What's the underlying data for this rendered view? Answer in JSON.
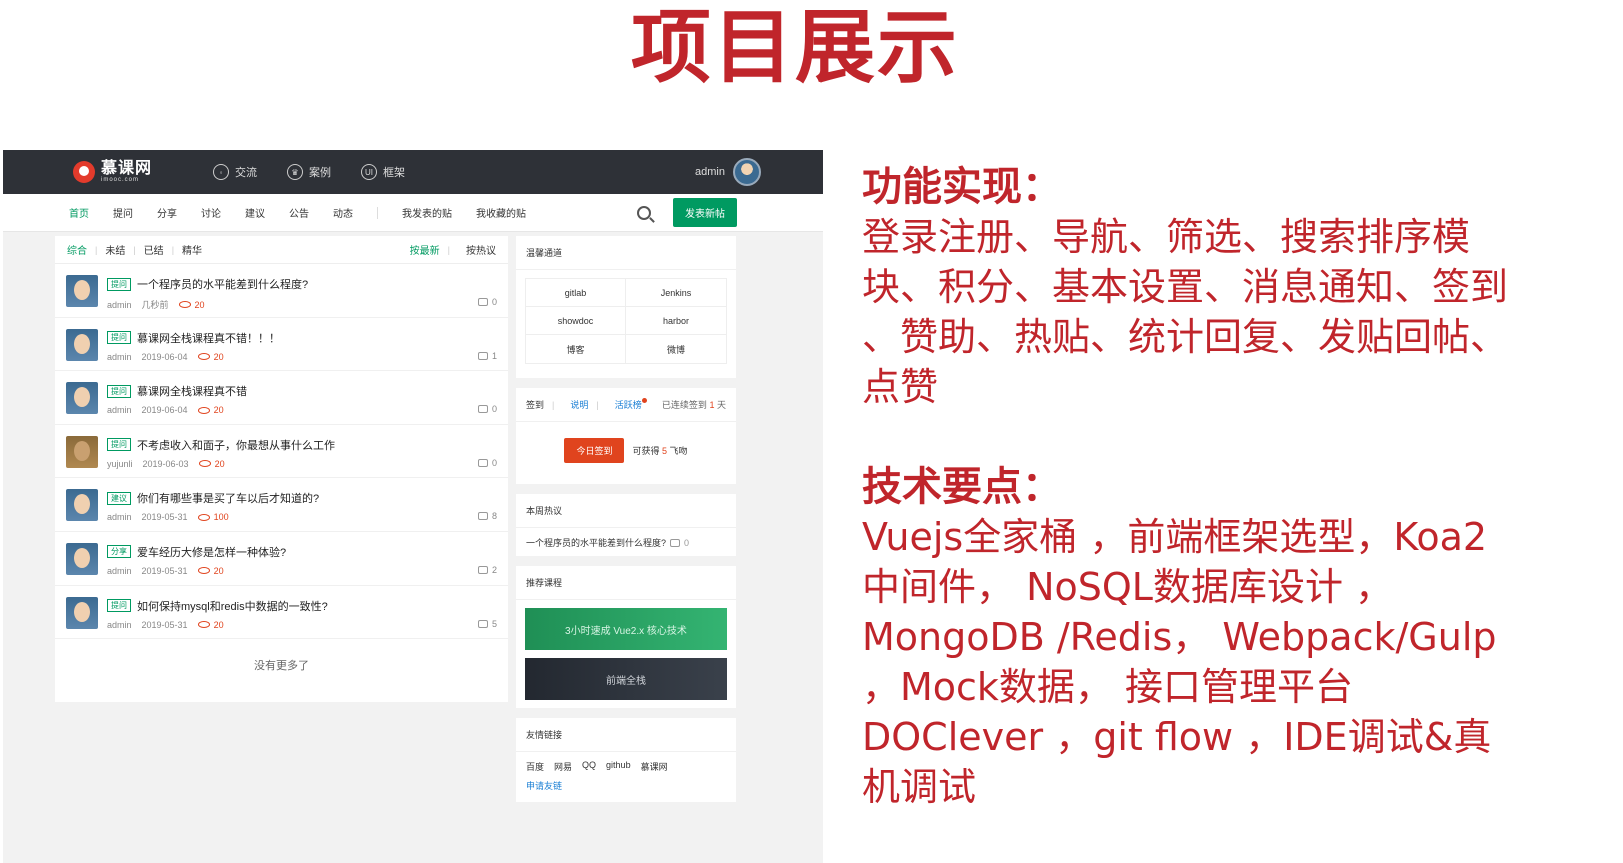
{
  "slide": {
    "title": "项目展示",
    "features_heading": "功能实现：",
    "features_lines": [
      "登录注册、导航、筛选、搜索排序模",
      "块、积分、基本设置、消息通知、签到",
      "、赞助、热贴、统计回复、发贴回帖、",
      "点赞"
    ],
    "tech_heading": "技术要点：",
    "tech_lines": [
      "Vuejs全家桶 ，前端框架选型，Koa2",
      "中间件， NoSQL数据库设计 ，",
      "MongoDB /Redis， Webpack/Gulp",
      "，Mock数据， 接口管理平台",
      "DOClever ，git flow ，IDE调试&真",
      "机调试"
    ],
    "colors": {
      "accent": "#c0252b"
    }
  },
  "app": {
    "logo": {
      "cn": "慕课网",
      "en": "imooc.com"
    },
    "topnav": [
      {
        "label": "交流",
        "icon": "chat-icon"
      },
      {
        "label": "案例",
        "icon": "crown-icon"
      },
      {
        "label": "框架",
        "icon": "ui-icon"
      }
    ],
    "user": {
      "name": "admin"
    },
    "subnav": [
      "首页",
      "提问",
      "分享",
      "讨论",
      "建议",
      "公告",
      "动态"
    ],
    "subnav_mine": [
      "我发表的贴",
      "我收藏的贴"
    ],
    "post_button": "发表新帖",
    "colors": {
      "brand_green": "#009a61",
      "topbar": "#2e3137",
      "orange": "#e0441e"
    }
  },
  "list": {
    "filters": [
      "综合",
      "未结",
      "已结",
      "精华"
    ],
    "sorts": [
      "按最新",
      "按热议"
    ],
    "rows": [
      {
        "tag": "提问",
        "title": "一个程序员的水平能差到什么程度?",
        "user": "admin",
        "time": "几秒前",
        "points": "20",
        "comments": "0"
      },
      {
        "tag": "提问",
        "title": "慕课网全栈课程真不错！！！",
        "user": "admin",
        "time": "2019-06-04",
        "points": "20",
        "comments": "1"
      },
      {
        "tag": "提问",
        "title": "慕课网全栈课程真不错",
        "user": "admin",
        "time": "2019-06-04",
        "points": "20",
        "comments": "0"
      },
      {
        "tag": "提问",
        "title": "不考虑收入和面子，你最想从事什么工作",
        "user": "yujunli",
        "time": "2019-06-03",
        "points": "20",
        "comments": "0"
      },
      {
        "tag": "建议",
        "title": "你们有哪些事是买了车以后才知道的?",
        "user": "admin",
        "time": "2019-05-31",
        "points": "100",
        "comments": "8"
      },
      {
        "tag": "分享",
        "title": "爱车经历大修是怎样一种体验?",
        "user": "admin",
        "time": "2019-05-31",
        "points": "20",
        "comments": "2"
      },
      {
        "tag": "提问",
        "title": "如何保持mysql和redis中数据的一致性?",
        "user": "admin",
        "time": "2019-05-31",
        "points": "20",
        "comments": "5"
      }
    ],
    "no_more": "没有更多了"
  },
  "sidebar": {
    "channels_title": "温馨通道",
    "channels": [
      "gitlab",
      "Jenkins",
      "showdoc",
      "harbor",
      "博客",
      "微博"
    ],
    "sign": {
      "label": "签到",
      "info": "说明",
      "rank": "活跃榜",
      "streak_prefix": "已连续签到",
      "streak_days": "1",
      "streak_unit": "天",
      "button": "今日签到",
      "reward_prefix": "可获得",
      "reward_num": "5",
      "reward_unit": "飞吻"
    },
    "hot_title": "本周热议",
    "hot_item": "一个程序员的水平能差到什么程度?",
    "hot_count": "0",
    "courses_title": "推荐课程",
    "course_a": "3小时速成 Vue2.x 核心技术",
    "course_b": "前端全栈",
    "links_title": "友情链接",
    "links": [
      "百度",
      "网易",
      "QQ",
      "github",
      "慕课网"
    ],
    "apply_link": "申请友链"
  }
}
